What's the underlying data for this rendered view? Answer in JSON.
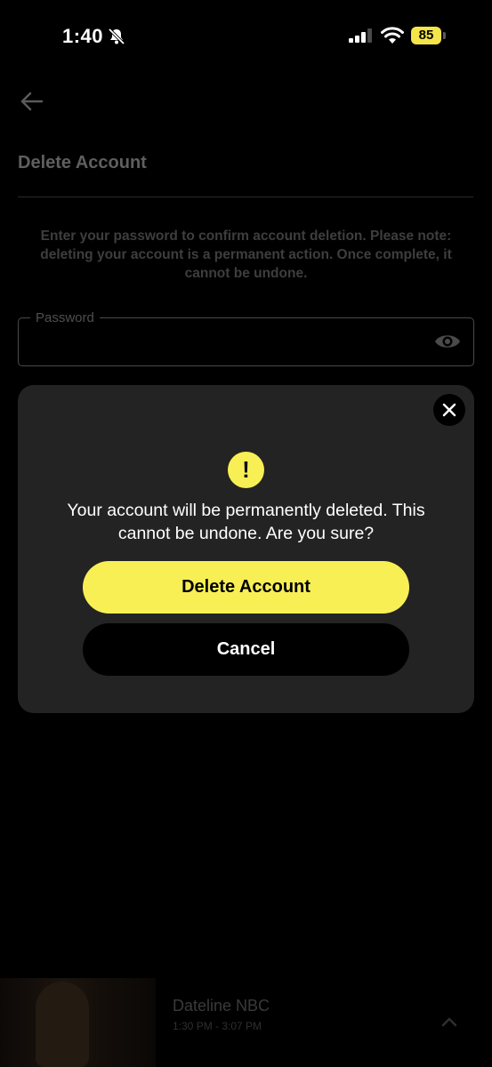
{
  "status_bar": {
    "time": "1:40",
    "battery": "85"
  },
  "colors": {
    "accent": "#f8ef55",
    "modal_bg": "#232323",
    "background": "#000000"
  },
  "page": {
    "title": "Delete Account",
    "info": "Enter your password to confirm account deletion. Please note: deleting your account is a permanent action. Once complete, it cannot be undone.",
    "password_label": "Password"
  },
  "modal": {
    "warning_symbol": "!",
    "message": "Your account will be permanently deleted. This cannot be undone. Are you sure?",
    "delete_label": "Delete Account",
    "cancel_label": "Cancel"
  },
  "mini_player": {
    "title": "Dateline NBC",
    "time": "1:30 PM - 3:07 PM"
  },
  "icons": [
    "bell-muted-icon",
    "signal-icon",
    "wifi-icon",
    "battery-icon",
    "back-arrow-icon",
    "eye-icon",
    "close-icon",
    "warning-icon",
    "chevron-up-icon"
  ]
}
